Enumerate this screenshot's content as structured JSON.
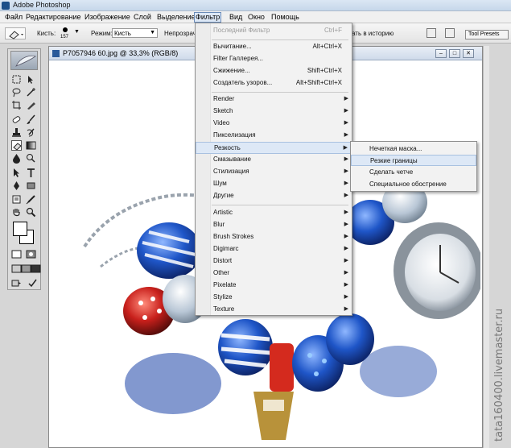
{
  "window": {
    "title": "Adobe Photoshop"
  },
  "menubar": [
    "Файл",
    "Редактирование",
    "Изображение",
    "Слой",
    "Выделение",
    "Фильтр",
    "Вид",
    "Окно",
    "Помощь"
  ],
  "menubar_active": "Фильтр",
  "options": {
    "brush_label": "Кисть:",
    "brush_size": "157",
    "mode_label": "Режим:",
    "mode_value": "Кисть",
    "opacity_label": "Непрозрачн",
    "history_label": "ать в историю",
    "tool_presets": "Tool Presets"
  },
  "document": {
    "title": "P7057946 60.jpg @ 33,3% (RGB/8)"
  },
  "filter_menu": {
    "top": [
      {
        "label": "Последний Фильтр",
        "shortcut": "Ctrl+F",
        "disabled": true
      }
    ],
    "group1": [
      {
        "label": "Вычитание...",
        "shortcut": "Alt+Ctrl+X"
      },
      {
        "label": "Filter Галлерея..."
      },
      {
        "label": "Сжижение...",
        "shortcut": "Shift+Ctrl+X"
      },
      {
        "label": "Создатель узоров...",
        "shortcut": "Alt+Shift+Ctrl+X"
      }
    ],
    "group2": [
      "Render",
      "Sketch",
      "Video",
      "Пикселизация",
      "Резкость",
      "Смазывание",
      "Стилизация",
      "Шум",
      "Другие"
    ],
    "group3": [
      "Artistic",
      "Blur",
      "Brush Strokes",
      "Digimarc",
      "Distort",
      "Other",
      "Pixelate",
      "Stylize",
      "Texture"
    ],
    "highlighted": "Резкость"
  },
  "sharpen_submenu": {
    "items": [
      "Нечеткая маска...",
      "Резкие границы",
      "Сделать четче",
      "Специальное обострение"
    ],
    "highlighted": "Резкие границы"
  },
  "watermark": "tata160400.livemaster.ru",
  "colors": {
    "menu_highlight": "#dde8f6",
    "title_blue": "#c6d7ea"
  }
}
